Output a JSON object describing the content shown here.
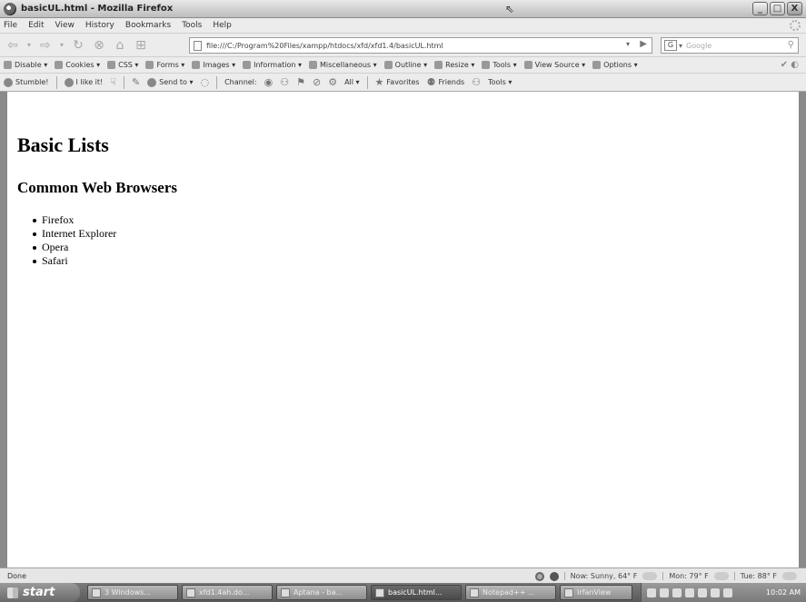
{
  "window": {
    "title": "basicUL.html - Mozilla Firefox",
    "controls": [
      "_",
      "□",
      "X"
    ]
  },
  "menubar": {
    "items": [
      "File",
      "Edit",
      "View",
      "History",
      "Bookmarks",
      "Tools",
      "Help"
    ]
  },
  "navbar": {
    "url": "file:///C:/Program%20Files/xampp/htdocs/xfd/xfd1.4/basicUL.html",
    "search_engine": "G",
    "search_placeholder": "Google"
  },
  "devbar": {
    "items": [
      "Disable ▾",
      "Cookies ▾",
      "CSS ▾",
      "Forms ▾",
      "Images ▾",
      "Information ▾",
      "Miscellaneous ▾",
      "Outline ▾",
      "Resize ▾",
      "Tools ▾",
      "View Source ▾",
      "Options ▾"
    ]
  },
  "stumblebar": {
    "stumble": "Stumble!",
    "like": "I like it!",
    "send": "Send to ▾",
    "channel": "Channel:",
    "all": "All ▾",
    "favorites": "Favorites",
    "friends": "Friends",
    "tools": "Tools ▾"
  },
  "page": {
    "heading": "Basic Lists",
    "subheading": "Common Web Browsers",
    "list": [
      "Firefox",
      "Internet Explorer",
      "Opera",
      "Safari"
    ]
  },
  "status": {
    "text": "Done",
    "now": "Now: Sunny, 64° F",
    "mon": "Mon: 79° F",
    "tue": "Tue: 88° F"
  },
  "taskbar": {
    "start": "start",
    "tasks": [
      "3 Windows...",
      "xfd1.4ah.do...",
      "Aptana - ba...",
      "basicUL.html...",
      "Notepad++ ...",
      "IrfanView"
    ],
    "clock": "10:02 AM"
  }
}
